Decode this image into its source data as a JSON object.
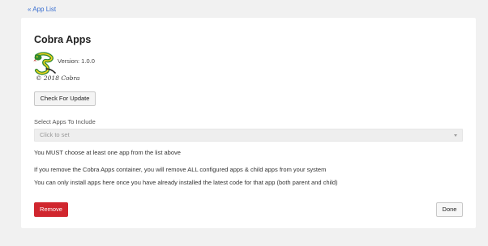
{
  "nav": {
    "back_link": "« App List"
  },
  "app": {
    "title": "Cobra Apps",
    "version": "Version: 1.0.0",
    "copyright": "© 2018 Cobra",
    "logo_icon": "cobra-logo-icon"
  },
  "actions": {
    "check_update_label": "Check For Update",
    "remove_label": "Remove",
    "done_label": "Done"
  },
  "apps_select": {
    "label": "Select Apps To Include",
    "placeholder": "Click to set"
  },
  "messages": {
    "must_choose": "You MUST choose at least one app from the list above",
    "remove_warning": "If you remove the Cobra Apps container, you will remove ALL configured apps & child apps from your system",
    "install_note": "You can only install apps here once you have already installed the latest code for that app (both parent and child)"
  },
  "colors": {
    "page_background": "#f1f1f1",
    "card_background": "#ffffff",
    "link": "#3a6fd0",
    "remove_button": "#d0262e",
    "logo_green": "#2f8a2f",
    "logo_yellow": "#f2d21a"
  }
}
